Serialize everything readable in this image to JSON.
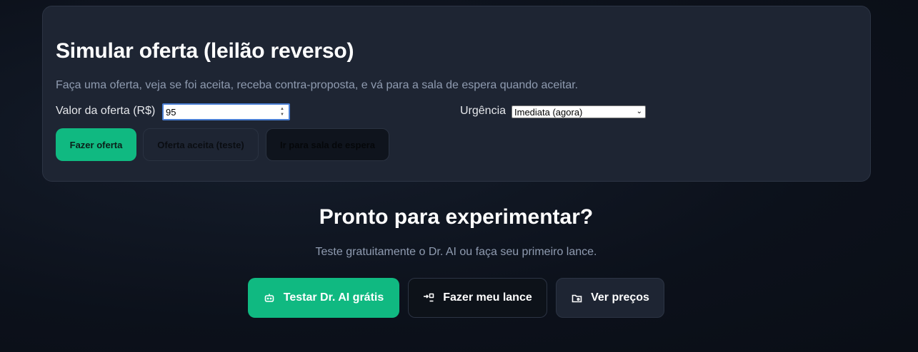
{
  "simulator": {
    "title": "Simular oferta (leilão reverso)",
    "subtitle": "Faça uma oferta, veja se foi aceita, receba contra-proposta, e vá para a sala de espera quando aceitar.",
    "offer_label": "Valor da oferta (R$)",
    "offer_value": "95",
    "urgency_label": "Urgência",
    "urgency_selected": "Imediata (agora)",
    "buttons": {
      "make_offer": "Fazer oferta",
      "offer_accepted": "Oferta aceita (teste)",
      "waiting_room": "Ir para sala de espera"
    }
  },
  "cta": {
    "title": "Pronto para experimentar?",
    "subtitle": "Teste gratuitamente o Dr. AI ou faça seu primeiro lance.",
    "buttons": {
      "test_ai": "Testar Dr. AI grátis",
      "make_bid": "Fazer meu lance",
      "see_prices": "Ver preços"
    },
    "icons": {
      "test_ai": "robot-icon",
      "make_bid": "login-arrow-icon",
      "see_prices": "folder-icon"
    }
  },
  "colors": {
    "accent": "#10b981",
    "card_bg": "#1e2533",
    "page_bg": "#0c111b",
    "focus_border": "#4a7fd4"
  }
}
